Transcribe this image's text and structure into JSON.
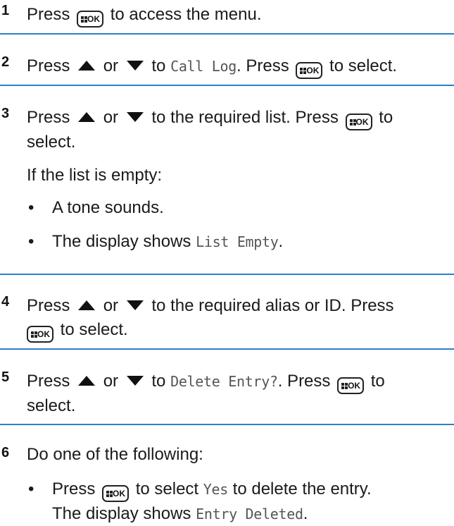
{
  "steps": [
    {
      "num": "1",
      "a": "Press",
      "b": "to access the menu."
    },
    {
      "num": "2",
      "a": "Press",
      "or": "or",
      "to": "to",
      "code": "Call Log",
      "c": ". Press",
      "d": "to select."
    },
    {
      "num": "3",
      "a": "Press",
      "or": "or",
      "to": "to the required list. Press",
      "d": "to",
      "e": "select.",
      "note": "If the list is empty:",
      "bullets": [
        "A tone sounds.",
        "The display shows"
      ],
      "code": "List Empty",
      "end": "."
    },
    {
      "num": "4",
      "a": "Press",
      "or": "or",
      "to": "to the required alias or ID. Press",
      "d": "to select."
    },
    {
      "num": "5",
      "a": "Press",
      "or": "or",
      "to": "to",
      "code": "Delete Entry?",
      "c": ". Press",
      "d": "to",
      "e": "select."
    },
    {
      "num": "6",
      "a": "Do one of the following:",
      "b1": "Press",
      "b2": "to select",
      "code1": "Yes",
      "b3": "to delete the entry.",
      "b4": "The display shows",
      "code2": "Entry Deleted",
      "end": "."
    }
  ],
  "icons": {
    "menu_ok": "menu-ok-button-icon",
    "up": "up-arrow-icon",
    "down": "down-arrow-icon"
  },
  "colors": {
    "rule": "#2f7fc4",
    "text": "#1a1a1a",
    "mono": "#555555"
  }
}
